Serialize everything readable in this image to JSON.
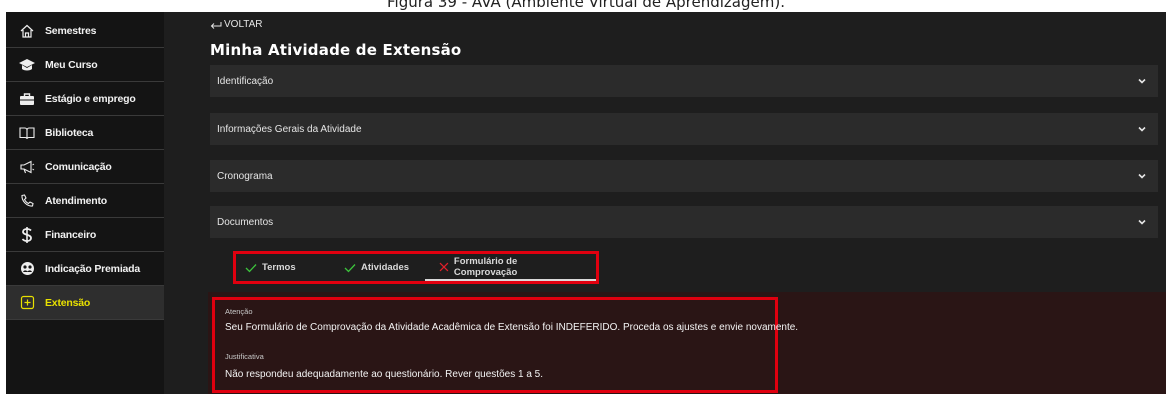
{
  "caption": "Figura 39 - AVA (Ambiente Virtual de Aprendizagem).",
  "sidebar": {
    "items": [
      {
        "label": "Semestres",
        "icon": "home-icon"
      },
      {
        "label": "Meu Curso",
        "icon": "graduation-cap-icon"
      },
      {
        "label": "Estágio e emprego",
        "icon": "briefcase-icon"
      },
      {
        "label": "Biblioteca",
        "icon": "book-icon"
      },
      {
        "label": "Comunicação",
        "icon": "megaphone-icon"
      },
      {
        "label": "Atendimento",
        "icon": "phone-icon"
      },
      {
        "label": "Financeiro",
        "icon": "dollar-icon"
      },
      {
        "label": "Indicação Premiada",
        "icon": "referral-icon"
      },
      {
        "label": "Extensão",
        "icon": "extension-icon"
      }
    ],
    "active_index": 8,
    "active_color": "#e8e000"
  },
  "header": {
    "back_label": "VOLTAR",
    "title": "Minha Atividade de Extensão"
  },
  "accordion": [
    {
      "label": "Identificação"
    },
    {
      "label": "Informações Gerais da Atividade"
    },
    {
      "label": "Cronograma"
    },
    {
      "label": "Documentos"
    }
  ],
  "tabs": [
    {
      "label": "Termos",
      "status": "done",
      "icon": "check-icon"
    },
    {
      "label": "Atividades",
      "status": "done",
      "icon": "check-icon"
    },
    {
      "label": "Formulário de Comprovação",
      "status": "rejected",
      "icon": "x-icon"
    }
  ],
  "alert": {
    "attention_label": "Atenção",
    "attention_text": "Seu Formulário de Comprovação da Atividade Acadêmica de Extensão foi INDEFERIDO. Proceda os ajustes e envie novamente.",
    "justification_label": "Justificativa",
    "justification_text": "Não respondeu adequadamente ao questionário. Rever questões 1 a 5."
  },
  "colors": {
    "highlight_border": "#e0000f",
    "check": "#3cc43c",
    "reject": "#e0202a"
  }
}
